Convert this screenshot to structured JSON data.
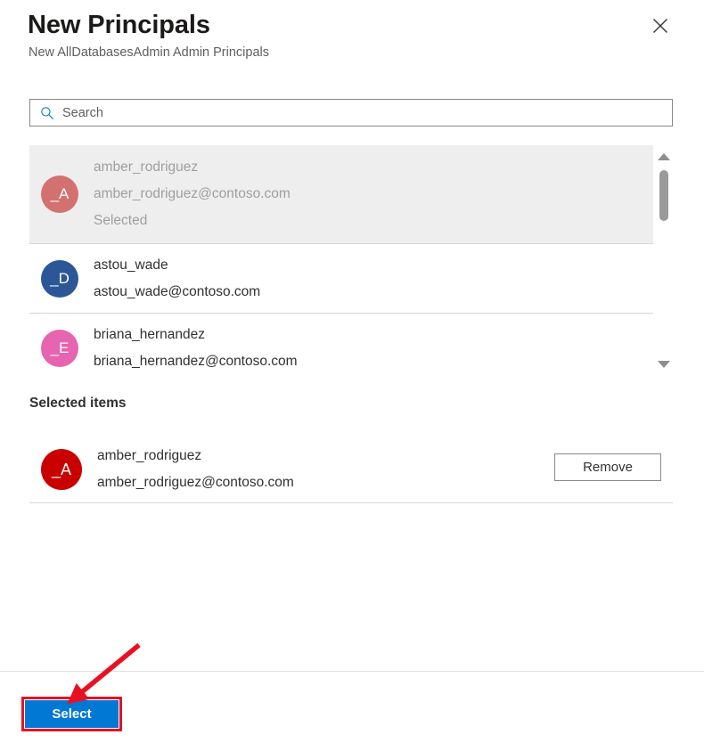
{
  "panel": {
    "title": "New Principals",
    "subtitle": "New AllDatabasesAdmin Admin Principals",
    "close_icon": "close-icon"
  },
  "search": {
    "icon": "search-icon",
    "placeholder": "Search",
    "value": ""
  },
  "results": {
    "items": [
      {
        "name": "amber_rodriguez",
        "email": "amber_rodriguez@contoso.com",
        "state": "Selected",
        "initials": "_A",
        "avatar_color": "#d2716f",
        "disabled": true
      },
      {
        "name": "astou_wade",
        "email": "astou_wade@contoso.com",
        "state": "",
        "initials": "_D",
        "avatar_color": "#2b5797",
        "disabled": false
      },
      {
        "name": "briana_hernandez",
        "email": "briana_hernandez@contoso.com",
        "state": "",
        "initials": "_E",
        "avatar_color": "#e664b0",
        "disabled": false
      }
    ],
    "scrollbar": {
      "up_icon": "chevron-up-icon",
      "down_icon": "chevron-down-icon"
    }
  },
  "selected_section": {
    "heading": "Selected items",
    "items": [
      {
        "name": "amber_rodriguez",
        "email": "amber_rodriguez@contoso.com",
        "initials": "_A",
        "avatar_color": "#c90000",
        "remove_label": "Remove"
      }
    ]
  },
  "footer": {
    "select_label": "Select"
  },
  "annotation": {
    "highlight_color": "#e81123",
    "arrow_color": "#e81123"
  }
}
